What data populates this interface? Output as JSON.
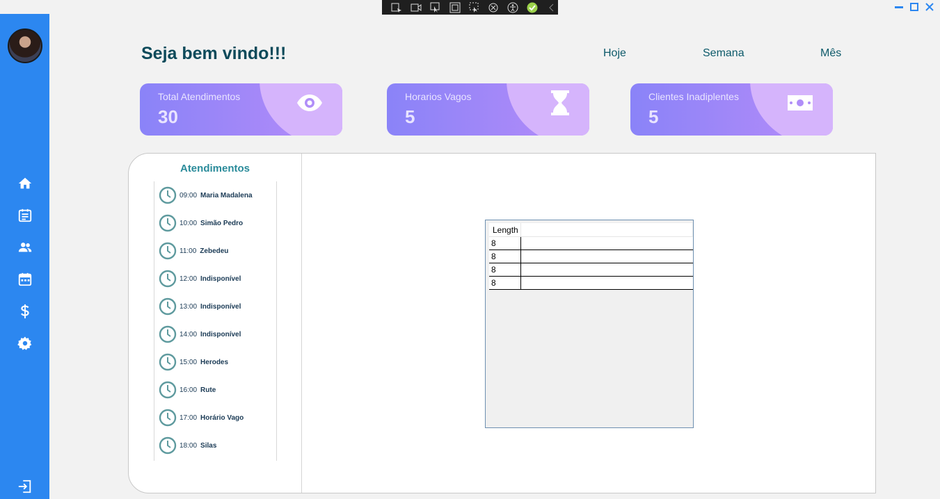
{
  "header": {
    "welcome": "Seja bem vindo!!!"
  },
  "periods": [
    "Hoje",
    "Semana",
    "Mês"
  ],
  "cards": [
    {
      "label": "Total Atendimentos",
      "value": "30",
      "icon": "eye-icon"
    },
    {
      "label": "Horarios Vagos",
      "value": "5",
      "icon": "hourglass-icon"
    },
    {
      "label": "Clientes Inadiplentes",
      "value": "5",
      "icon": "money-icon"
    }
  ],
  "appointments": {
    "title": "Atendimentos",
    "items": [
      {
        "time": "09:00",
        "name": "Maria Madalena"
      },
      {
        "time": "10:00",
        "name": "Simão Pedro"
      },
      {
        "time": "11:00",
        "name": "Zebedeu"
      },
      {
        "time": "12:00",
        "name": "Indisponível"
      },
      {
        "time": "13:00",
        "name": "Indisponível"
      },
      {
        "time": "14:00",
        "name": "Indisponível"
      },
      {
        "time": "15:00",
        "name": "Herodes"
      },
      {
        "time": "16:00",
        "name": "Rute"
      },
      {
        "time": "17:00",
        "name": "Horário Vago"
      },
      {
        "time": "18:00",
        "name": "Silas"
      }
    ]
  },
  "grid": {
    "column": "Length",
    "rows": [
      "8",
      "8",
      "8",
      "8"
    ]
  },
  "sidebar": {
    "items": [
      "home-icon",
      "notes-icon",
      "people-icon",
      "calendar-icon",
      "dollar-icon",
      "gear-icon"
    ],
    "logout": "logout-icon"
  },
  "colors": {
    "sidebar": "#2c87f0",
    "accent": "#0d4a5a",
    "card_from": "#8a83f8",
    "card_to": "#b78cf9"
  }
}
